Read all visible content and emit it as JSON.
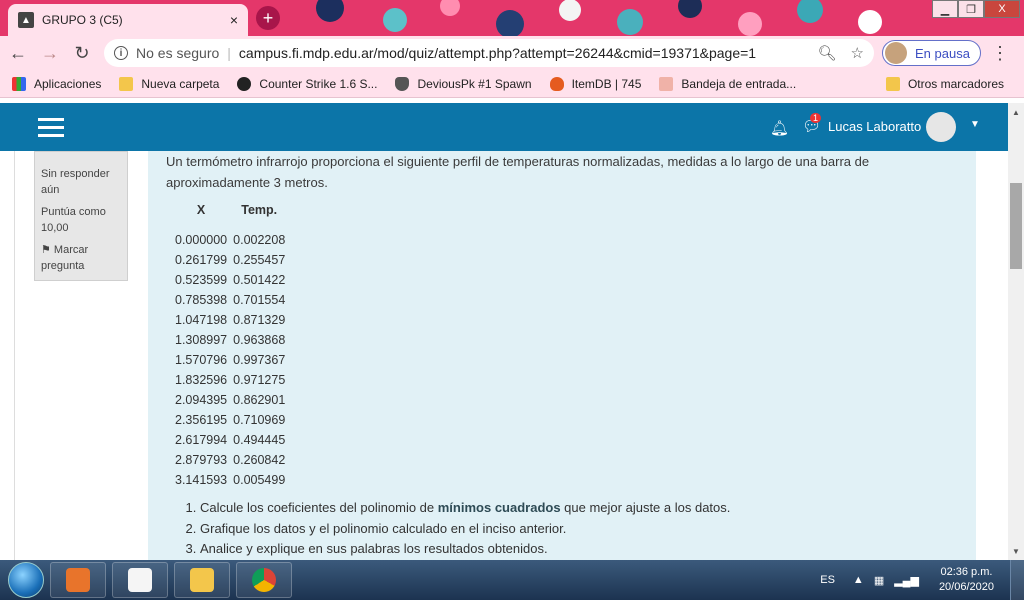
{
  "browser": {
    "tab_title": "GRUPO 3 (C5)",
    "tab_close": "×",
    "new_tab": "+",
    "win_controls": [
      "▁",
      "❐",
      "X"
    ],
    "security_label": "No es seguro",
    "url": "campus.fi.mdp.edu.ar/mod/quiz/attempt.php?attempt=26244&cmid=19371&page=1",
    "profile_status": "En pausa"
  },
  "bookmarks": {
    "items": [
      {
        "label": "Aplicaciones",
        "icon": "apps-grid-icon"
      },
      {
        "label": "Nueva carpeta",
        "icon": "folder-icon"
      },
      {
        "label": "Counter Strike 1.6 S...",
        "icon": "counter-strike-icon"
      },
      {
        "label": "DeviousPk #1 Spawn",
        "icon": "shield-icon"
      },
      {
        "label": "ItemDB | 745",
        "icon": "fire-icon"
      },
      {
        "label": "Bandeja de entrada...",
        "icon": "foro-icon"
      }
    ],
    "other": "Otros marcadores"
  },
  "moodle": {
    "user_name": "Lucas Laboratto",
    "message_badge": "1"
  },
  "sidebar_info": {
    "status": "Sin responder aún",
    "score": "Puntúa como 10,00",
    "flag": "Marcar pregunta"
  },
  "question": {
    "intro": "Un termómetro infrarrojo proporciona el siguiente perfil de temperaturas normalizadas, medidas a lo largo de una barra de aproximadamente 3 metros.",
    "table_headers": [
      "X",
      "Temp."
    ],
    "rows": [
      [
        "0.000000",
        "0.002208"
      ],
      [
        "0.261799",
        "0.255457"
      ],
      [
        "0.523599",
        "0.501422"
      ],
      [
        "0.785398",
        "0.701554"
      ],
      [
        "1.047198",
        "0.871329"
      ],
      [
        "1.308997",
        "0.963868"
      ],
      [
        "1.570796",
        "0.997367"
      ],
      [
        "1.832596",
        "0.971275"
      ],
      [
        "2.094395",
        "0.862901"
      ],
      [
        "2.356195",
        "0.710969"
      ],
      [
        "2.617994",
        "0.494445"
      ],
      [
        "2.879793",
        "0.260842"
      ],
      [
        "3.141593",
        "0.005499"
      ]
    ],
    "tasks": [
      {
        "before": "Calcule los coeficientes del polinomio de ",
        "bold": "mínimos cuadrados",
        "after": " que mejor ajuste a los datos."
      },
      {
        "before": "Grafique los datos y el polinomio calculado en el inciso anterior.",
        "bold": "",
        "after": ""
      },
      {
        "before": "Analice y explique en sus palabras los resultados obtenidos.",
        "bold": "",
        "after": ""
      }
    ]
  },
  "taskbar": {
    "language": "ES",
    "time": "02:36 p.m.",
    "date": "20/06/2020"
  }
}
